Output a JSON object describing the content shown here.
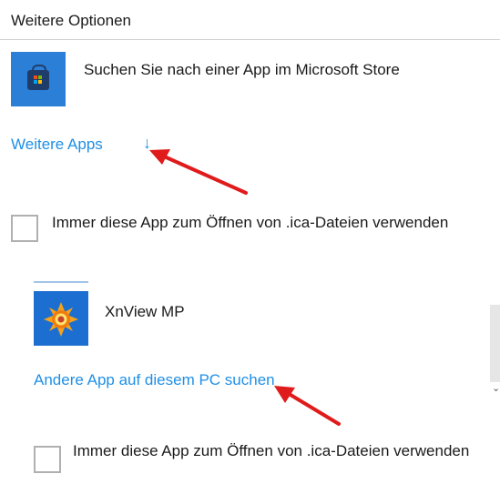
{
  "section": {
    "title": "Weitere Optionen"
  },
  "store_option": {
    "text": "Suchen Sie nach einer App im Microsoft Store",
    "icon": "microsoft-store-icon"
  },
  "more_apps": {
    "label": "Weitere Apps",
    "arrow": "↓"
  },
  "always_use_1": {
    "label": "Immer diese App zum Öffnen von .ica-Dateien verwenden",
    "checked": false
  },
  "app_list": [
    {
      "name": "XnView MP",
      "icon": "xnview-icon"
    }
  ],
  "other_app": {
    "label": "Andere App auf diesem PC suchen"
  },
  "always_use_2": {
    "label": "Immer diese App zum Öffnen von .ica-Dateien verwenden",
    "checked": false
  },
  "annotations": {
    "arrow_color": "#e01b1b",
    "count": 2
  },
  "colors": {
    "link": "#1f8fe6",
    "store_tile": "#2b7fd6",
    "xnview_tile": "#1c6fd1"
  }
}
